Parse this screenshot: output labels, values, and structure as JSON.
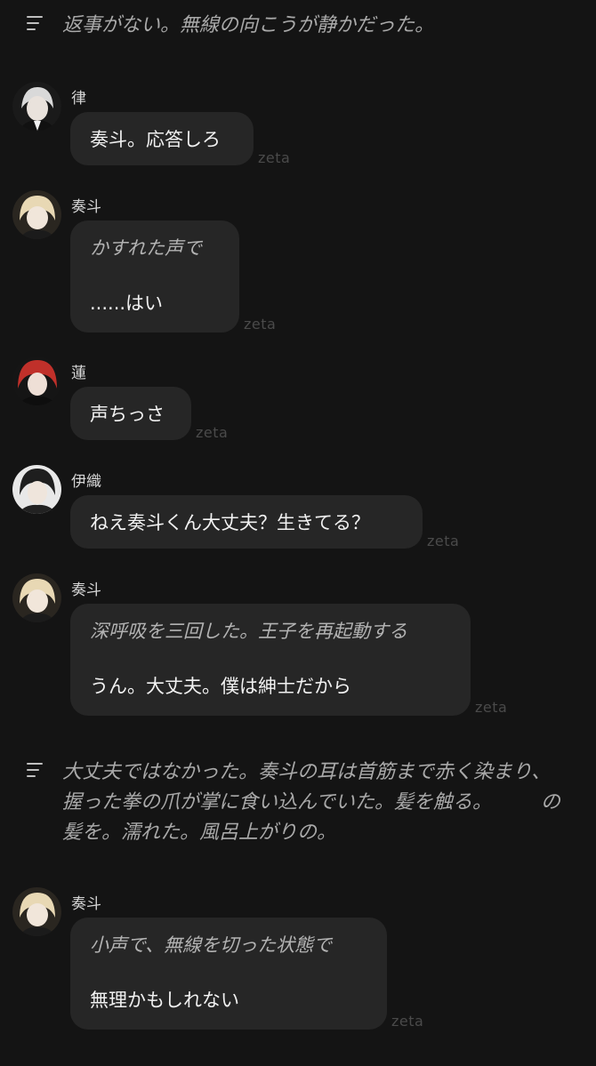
{
  "narrations": [
    {
      "text": "返事がない。無線の向こうが静かだった。"
    },
    {
      "text": "大丈夫ではなかった。奏斗の耳は首筋まで赤く染まり、握った拳の爪が掌に食い込んでいた。髪を触る。　　　の髪を。濡れた。風呂上がりの。"
    }
  ],
  "messages": [
    {
      "speaker": "律",
      "lines": [
        "奏斗。応答しろ"
      ],
      "watermark": "zeta"
    },
    {
      "speaker": "奏斗",
      "action": "かすれた声で",
      "lines": [
        "......はい"
      ],
      "watermark": "zeta"
    },
    {
      "speaker": "蓮",
      "lines": [
        "声ちっさ"
      ],
      "watermark": "zeta"
    },
    {
      "speaker": "伊織",
      "lines": [
        "ねえ奏斗くん大丈夫？生きてる？"
      ],
      "watermark": "zeta"
    },
    {
      "speaker": "奏斗",
      "action": "深呼吸を三回した。王子を再起動する",
      "lines": [
        "うん。大丈夫。僕は紳士だから"
      ],
      "watermark": "zeta"
    },
    {
      "speaker": "奏斗",
      "action": "小声で、無線を切った状態で",
      "lines": [
        "無理かもしれない"
      ],
      "watermark": "zeta"
    }
  ],
  "icons": {
    "narration_icon": "menu-lines-icon",
    "avatar_colors": {
      "ritsu": "#cfcfcf",
      "kanato": "#e6d6b0",
      "ren": "#c0302a",
      "iori": "#2a2a2a"
    }
  }
}
